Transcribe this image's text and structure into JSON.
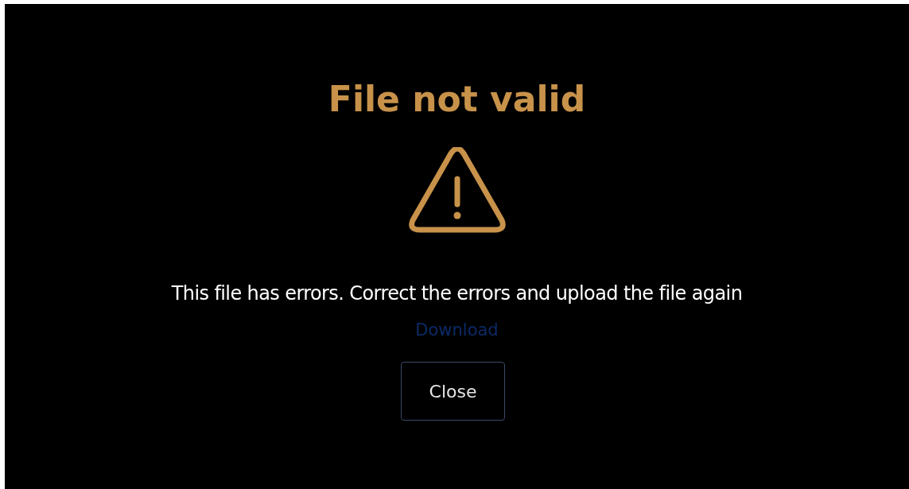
{
  "dialog": {
    "title": "File not valid",
    "message": "This file has errors. Correct the errors and upload the file again",
    "link": "Download",
    "buttons": [
      "Close"
    ]
  }
}
